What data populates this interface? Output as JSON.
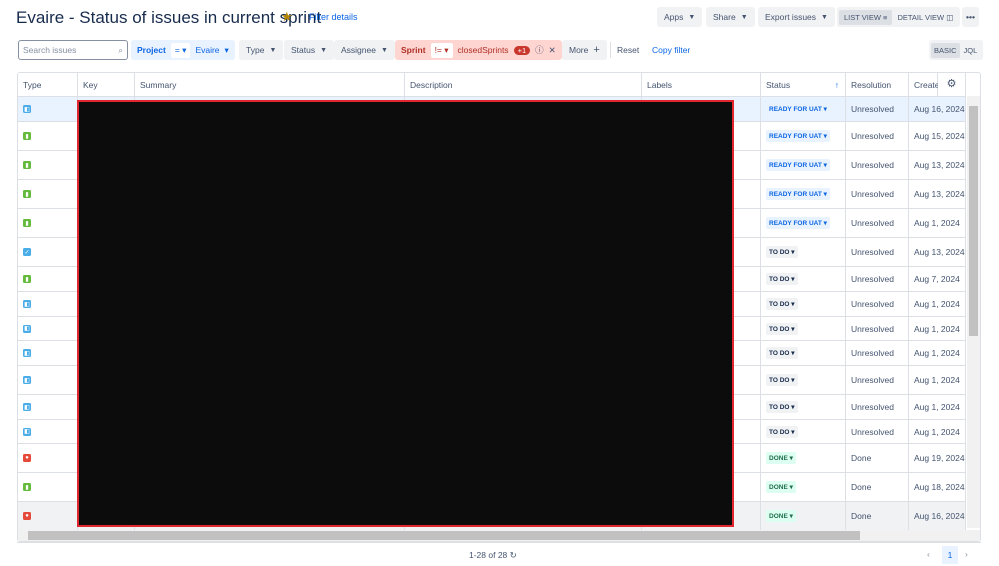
{
  "header": {
    "title": "Evaire - Status of issues in current sprint",
    "filter_details": "Filter details",
    "apps": "Apps",
    "share": "Share",
    "export": "Export issues",
    "list_view": "LIST VIEW",
    "detail_view": "DETAIL VIEW",
    "more": "•••"
  },
  "filters": {
    "search_placeholder": "Search issues",
    "project_label": "Project",
    "project_op": "=",
    "project_value": "Evaire",
    "type": "Type",
    "status": "Status",
    "assignee": "Assignee",
    "sprint_label": "Sprint",
    "sprint_op": "!=",
    "sprint_value": "closedSprints",
    "sprint_extra": "+1",
    "more": "More",
    "reset": "Reset",
    "copy_filter": "Copy filter",
    "basic": "BASIC",
    "jql": "JQL"
  },
  "columns": [
    "Type",
    "Key",
    "Summary",
    "Description",
    "Labels",
    "Status",
    "Resolution",
    "Created"
  ],
  "rows": [
    {
      "type": "subtask",
      "status": "READY FOR UAT",
      "resolution": "Unresolved",
      "created": "Aug 16, 2024"
    },
    {
      "type": "story",
      "status": "READY FOR UAT",
      "resolution": "Unresolved",
      "created": "Aug 15, 2024"
    },
    {
      "type": "story",
      "status": "READY FOR UAT",
      "resolution": "Unresolved",
      "created": "Aug 13, 2024"
    },
    {
      "type": "story",
      "status": "READY FOR UAT",
      "resolution": "Unresolved",
      "created": "Aug 13, 2024"
    },
    {
      "type": "story",
      "status": "READY FOR UAT",
      "resolution": "Unresolved",
      "created": "Aug 1, 2024"
    },
    {
      "type": "task",
      "status": "TO DO",
      "resolution": "Unresolved",
      "created": "Aug 13, 2024"
    },
    {
      "type": "story",
      "status": "TO DO",
      "resolution": "Unresolved",
      "created": "Aug 7, 2024"
    },
    {
      "type": "subtask",
      "status": "TO DO",
      "resolution": "Unresolved",
      "created": "Aug 1, 2024"
    },
    {
      "type": "subtask",
      "status": "TO DO",
      "resolution": "Unresolved",
      "created": "Aug 1, 2024"
    },
    {
      "type": "subtask",
      "status": "TO DO",
      "resolution": "Unresolved",
      "created": "Aug 1, 2024"
    },
    {
      "type": "subtask",
      "status": "TO DO",
      "resolution": "Unresolved",
      "created": "Aug 1, 2024"
    },
    {
      "type": "subtask",
      "status": "TO DO",
      "resolution": "Unresolved",
      "created": "Aug 1, 2024"
    },
    {
      "type": "subtask",
      "status": "TO DO",
      "resolution": "Unresolved",
      "created": "Aug 1, 2024"
    },
    {
      "type": "bug",
      "status": "DONE",
      "resolution": "Done",
      "created": "Aug 19, 2024"
    },
    {
      "type": "story",
      "status": "DONE",
      "resolution": "Done",
      "created": "Aug 18, 2024"
    },
    {
      "type": "bug",
      "status": "DONE",
      "resolution": "Done",
      "created": "Aug 16, 2024"
    }
  ],
  "footer": {
    "count": "1-28 of 28",
    "page": "1"
  },
  "colors": {
    "accent": "#0c66e4",
    "story": "#63ba3c",
    "subtask": "#4bade8",
    "task": "#4bade8",
    "bug": "#e5493a"
  }
}
